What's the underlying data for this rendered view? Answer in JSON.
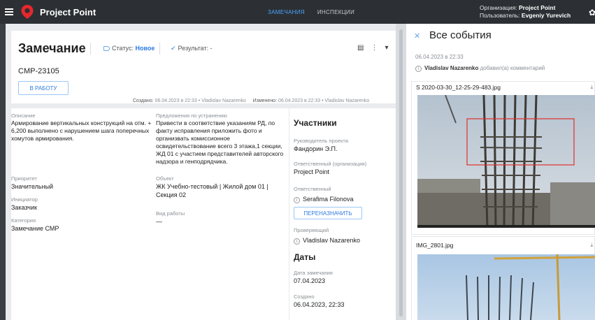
{
  "header": {
    "app_title": "Project Point",
    "tabs": [
      "ЗАМЕЧАНИЯ",
      "ИНСПЕКЦИИ"
    ],
    "org_label": "Организация:",
    "org_value": "Project Point",
    "user_label": "Пользователь:",
    "user_value": "Evgeniy Yurevich"
  },
  "issue": {
    "title": "Замечание",
    "status_label": "Статус:",
    "status_value": "Новое",
    "result_label": "Результат: -",
    "code": "CMP-23105",
    "work_button": "В РАБОТУ",
    "created_label": "Создано:",
    "created_value": "06.04.2023 в 22:33 • Vladislav Nazarenko",
    "modified_label": "Изменено:",
    "modified_value": "06.04.2023 в 22:33 • Vladislav Nazarenko"
  },
  "details": {
    "description_label": "Описание",
    "description_value": "Армирование вертикальных конструкций на отм. + 6,200 выполнено с нарушением шага поперечных хомутов армирования.",
    "proposal_label": "Предложения по устранению",
    "proposal_value": "Привести в соответствие указаниям РД, по факту исправления приложить фото и организвать комиссионное освидетельствование всего 3 этажа,1 секции, ЖД 01 с участием представителей авторского надзора и генподрядчика.",
    "priority_label": "Приоритет",
    "priority_value": "Значительный",
    "initiator_label": "Инициатор",
    "initiator_value": "Заказчик",
    "category_label": "Категория",
    "category_value": "Замечание СМР",
    "object_label": "Объект",
    "object_value": "ЖК Учебно-тестовый | Жилой дом 01 | Секция 02",
    "work_type_label": "Вид работы",
    "work_type_value": "—"
  },
  "participants": {
    "title": "Участники",
    "head_label": "Руководитель проекта",
    "head_value": "Фандорин Э.П.",
    "resp_org_label": "Ответственный (организация)",
    "resp_org_value": "Project Point",
    "resp_label": "Ответственный",
    "resp_value": "Serafima Filonova",
    "reassign_button": "ПЕРЕНАЗНАЧИТЬ",
    "checker_label": "Проверяющий",
    "checker_value": "Vladislav Nazarenko"
  },
  "dates": {
    "title": "Даты",
    "issue_date_label": "Дата замечания",
    "issue_date_value": "07.04.2023",
    "created_label": "Создано",
    "created_value": "06.04.2023, 22:33"
  },
  "events": {
    "title": "Все события",
    "date": "06.04.2023 в 22:33",
    "author": "Vladislav Nazarenko",
    "action": "добавил(а) комментарий",
    "attachments": [
      "S 2020-03-30_12-25-29-483.jpg",
      "IMG_2801.jpg"
    ]
  }
}
